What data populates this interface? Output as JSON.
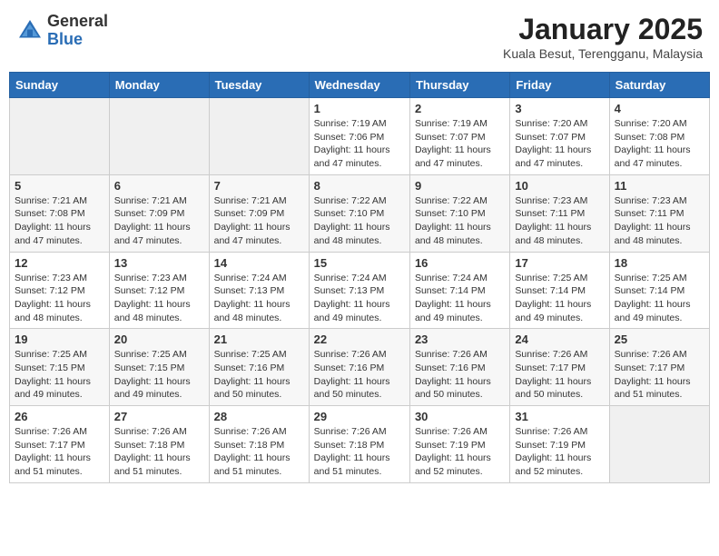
{
  "header": {
    "logo_general": "General",
    "logo_blue": "Blue",
    "month": "January 2025",
    "location": "Kuala Besut, Terengganu, Malaysia"
  },
  "days_of_week": [
    "Sunday",
    "Monday",
    "Tuesday",
    "Wednesday",
    "Thursday",
    "Friday",
    "Saturday"
  ],
  "weeks": [
    [
      {
        "day": "",
        "sunrise": "",
        "sunset": "",
        "daylight": ""
      },
      {
        "day": "",
        "sunrise": "",
        "sunset": "",
        "daylight": ""
      },
      {
        "day": "",
        "sunrise": "",
        "sunset": "",
        "daylight": ""
      },
      {
        "day": "1",
        "sunrise": "Sunrise: 7:19 AM",
        "sunset": "Sunset: 7:06 PM",
        "daylight": "Daylight: 11 hours and 47 minutes."
      },
      {
        "day": "2",
        "sunrise": "Sunrise: 7:19 AM",
        "sunset": "Sunset: 7:07 PM",
        "daylight": "Daylight: 11 hours and 47 minutes."
      },
      {
        "day": "3",
        "sunrise": "Sunrise: 7:20 AM",
        "sunset": "Sunset: 7:07 PM",
        "daylight": "Daylight: 11 hours and 47 minutes."
      },
      {
        "day": "4",
        "sunrise": "Sunrise: 7:20 AM",
        "sunset": "Sunset: 7:08 PM",
        "daylight": "Daylight: 11 hours and 47 minutes."
      }
    ],
    [
      {
        "day": "5",
        "sunrise": "Sunrise: 7:21 AM",
        "sunset": "Sunset: 7:08 PM",
        "daylight": "Daylight: 11 hours and 47 minutes."
      },
      {
        "day": "6",
        "sunrise": "Sunrise: 7:21 AM",
        "sunset": "Sunset: 7:09 PM",
        "daylight": "Daylight: 11 hours and 47 minutes."
      },
      {
        "day": "7",
        "sunrise": "Sunrise: 7:21 AM",
        "sunset": "Sunset: 7:09 PM",
        "daylight": "Daylight: 11 hours and 47 minutes."
      },
      {
        "day": "8",
        "sunrise": "Sunrise: 7:22 AM",
        "sunset": "Sunset: 7:10 PM",
        "daylight": "Daylight: 11 hours and 48 minutes."
      },
      {
        "day": "9",
        "sunrise": "Sunrise: 7:22 AM",
        "sunset": "Sunset: 7:10 PM",
        "daylight": "Daylight: 11 hours and 48 minutes."
      },
      {
        "day": "10",
        "sunrise": "Sunrise: 7:23 AM",
        "sunset": "Sunset: 7:11 PM",
        "daylight": "Daylight: 11 hours and 48 minutes."
      },
      {
        "day": "11",
        "sunrise": "Sunrise: 7:23 AM",
        "sunset": "Sunset: 7:11 PM",
        "daylight": "Daylight: 11 hours and 48 minutes."
      }
    ],
    [
      {
        "day": "12",
        "sunrise": "Sunrise: 7:23 AM",
        "sunset": "Sunset: 7:12 PM",
        "daylight": "Daylight: 11 hours and 48 minutes."
      },
      {
        "day": "13",
        "sunrise": "Sunrise: 7:23 AM",
        "sunset": "Sunset: 7:12 PM",
        "daylight": "Daylight: 11 hours and 48 minutes."
      },
      {
        "day": "14",
        "sunrise": "Sunrise: 7:24 AM",
        "sunset": "Sunset: 7:13 PM",
        "daylight": "Daylight: 11 hours and 48 minutes."
      },
      {
        "day": "15",
        "sunrise": "Sunrise: 7:24 AM",
        "sunset": "Sunset: 7:13 PM",
        "daylight": "Daylight: 11 hours and 49 minutes."
      },
      {
        "day": "16",
        "sunrise": "Sunrise: 7:24 AM",
        "sunset": "Sunset: 7:14 PM",
        "daylight": "Daylight: 11 hours and 49 minutes."
      },
      {
        "day": "17",
        "sunrise": "Sunrise: 7:25 AM",
        "sunset": "Sunset: 7:14 PM",
        "daylight": "Daylight: 11 hours and 49 minutes."
      },
      {
        "day": "18",
        "sunrise": "Sunrise: 7:25 AM",
        "sunset": "Sunset: 7:14 PM",
        "daylight": "Daylight: 11 hours and 49 minutes."
      }
    ],
    [
      {
        "day": "19",
        "sunrise": "Sunrise: 7:25 AM",
        "sunset": "Sunset: 7:15 PM",
        "daylight": "Daylight: 11 hours and 49 minutes."
      },
      {
        "day": "20",
        "sunrise": "Sunrise: 7:25 AM",
        "sunset": "Sunset: 7:15 PM",
        "daylight": "Daylight: 11 hours and 49 minutes."
      },
      {
        "day": "21",
        "sunrise": "Sunrise: 7:25 AM",
        "sunset": "Sunset: 7:16 PM",
        "daylight": "Daylight: 11 hours and 50 minutes."
      },
      {
        "day": "22",
        "sunrise": "Sunrise: 7:26 AM",
        "sunset": "Sunset: 7:16 PM",
        "daylight": "Daylight: 11 hours and 50 minutes."
      },
      {
        "day": "23",
        "sunrise": "Sunrise: 7:26 AM",
        "sunset": "Sunset: 7:16 PM",
        "daylight": "Daylight: 11 hours and 50 minutes."
      },
      {
        "day": "24",
        "sunrise": "Sunrise: 7:26 AM",
        "sunset": "Sunset: 7:17 PM",
        "daylight": "Daylight: 11 hours and 50 minutes."
      },
      {
        "day": "25",
        "sunrise": "Sunrise: 7:26 AM",
        "sunset": "Sunset: 7:17 PM",
        "daylight": "Daylight: 11 hours and 51 minutes."
      }
    ],
    [
      {
        "day": "26",
        "sunrise": "Sunrise: 7:26 AM",
        "sunset": "Sunset: 7:17 PM",
        "daylight": "Daylight: 11 hours and 51 minutes."
      },
      {
        "day": "27",
        "sunrise": "Sunrise: 7:26 AM",
        "sunset": "Sunset: 7:18 PM",
        "daylight": "Daylight: 11 hours and 51 minutes."
      },
      {
        "day": "28",
        "sunrise": "Sunrise: 7:26 AM",
        "sunset": "Sunset: 7:18 PM",
        "daylight": "Daylight: 11 hours and 51 minutes."
      },
      {
        "day": "29",
        "sunrise": "Sunrise: 7:26 AM",
        "sunset": "Sunset: 7:18 PM",
        "daylight": "Daylight: 11 hours and 51 minutes."
      },
      {
        "day": "30",
        "sunrise": "Sunrise: 7:26 AM",
        "sunset": "Sunset: 7:19 PM",
        "daylight": "Daylight: 11 hours and 52 minutes."
      },
      {
        "day": "31",
        "sunrise": "Sunrise: 7:26 AM",
        "sunset": "Sunset: 7:19 PM",
        "daylight": "Daylight: 11 hours and 52 minutes."
      },
      {
        "day": "",
        "sunrise": "",
        "sunset": "",
        "daylight": ""
      }
    ]
  ]
}
